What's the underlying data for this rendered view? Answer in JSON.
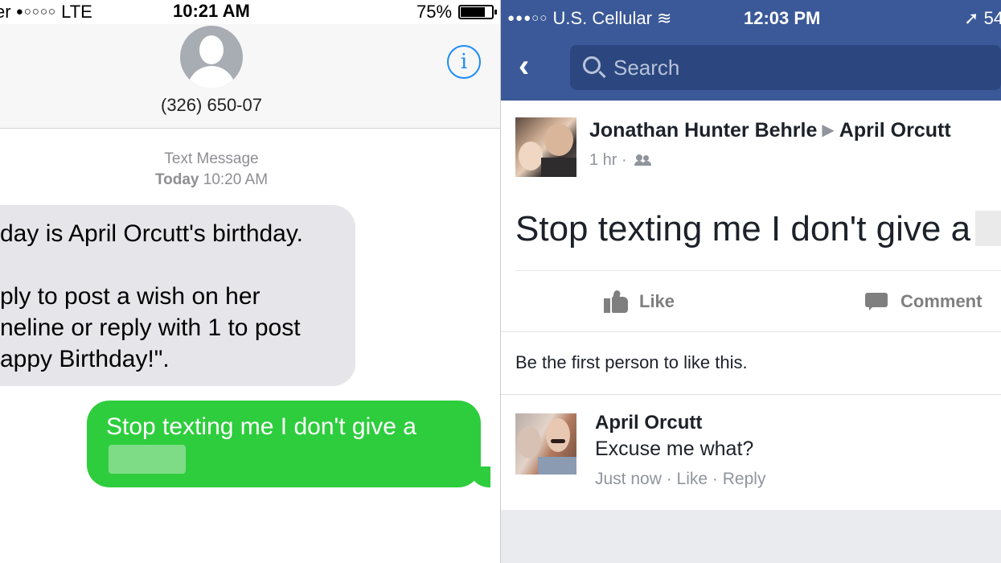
{
  "imessage": {
    "status": {
      "carrier": "er",
      "signal": "●○○○○",
      "network": "LTE",
      "time": "10:21 AM",
      "battery": "75%"
    },
    "contact": "(326) 650-07",
    "meta_label": "Text Message",
    "meta_day": "Today",
    "meta_time": "10:20 AM",
    "incoming_lines": [
      "day is April Orcutt's birthday.",
      "",
      "ply to post a wish on her",
      "neline or reply with 1 to post",
      "appy Birthday!\"."
    ],
    "outgoing_text": "Stop texting me I don't give a",
    "colors": {
      "incoming": "#e5e5ea",
      "outgoing": "#2ecd3d",
      "accent": "#1d8cf8"
    }
  },
  "facebook": {
    "status": {
      "signal": "●●●○○",
      "carrier": "U.S. Cellular",
      "time": "12:03 PM",
      "battery": "54"
    },
    "search_placeholder": "Search",
    "post": {
      "author": "Jonathan Hunter Behrle",
      "target": "April Orcutt",
      "time": "1 hr",
      "text": "Stop texting me I don't give a"
    },
    "actions": {
      "like": "Like",
      "comment": "Comment"
    },
    "likes_line": "Be the first person to like this.",
    "comment": {
      "name": "April Orcutt",
      "text": "Excuse me what?",
      "time": "Just now",
      "like": "Like",
      "reply": "Reply"
    },
    "colors": {
      "brand": "#3b5998",
      "search_bg": "#2c477f",
      "muted": "#90949c"
    }
  }
}
